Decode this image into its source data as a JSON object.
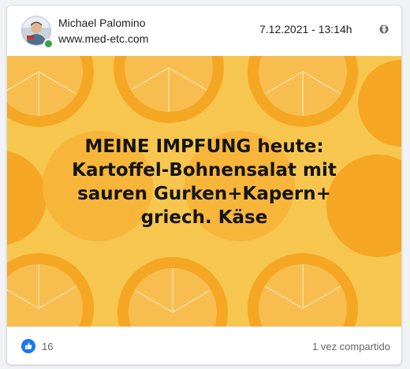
{
  "post": {
    "author": "Michael Palomino",
    "subtitle": "www.med-etc.com",
    "timestamp": "7.12.2021 - 13:14h",
    "privacy_icon": "globe-icon",
    "image_text": {
      "line1": "MEINE IMPFUNG heute:",
      "line2": "Kartoffel-Bohnensalat mit",
      "line3": "sauren Gurken+Kapern+",
      "line4": "griech. Käse"
    },
    "image_background": "orange-slices-pattern",
    "reactions": {
      "icon": "like-icon",
      "count": "16"
    },
    "shares_label": "1 vez compartido"
  },
  "colors": {
    "background": "#f6c64f",
    "orange": "#f5a623",
    "light_orange": "#fbd985",
    "like_blue": "#1877f2",
    "online_green": "#31a24c"
  }
}
